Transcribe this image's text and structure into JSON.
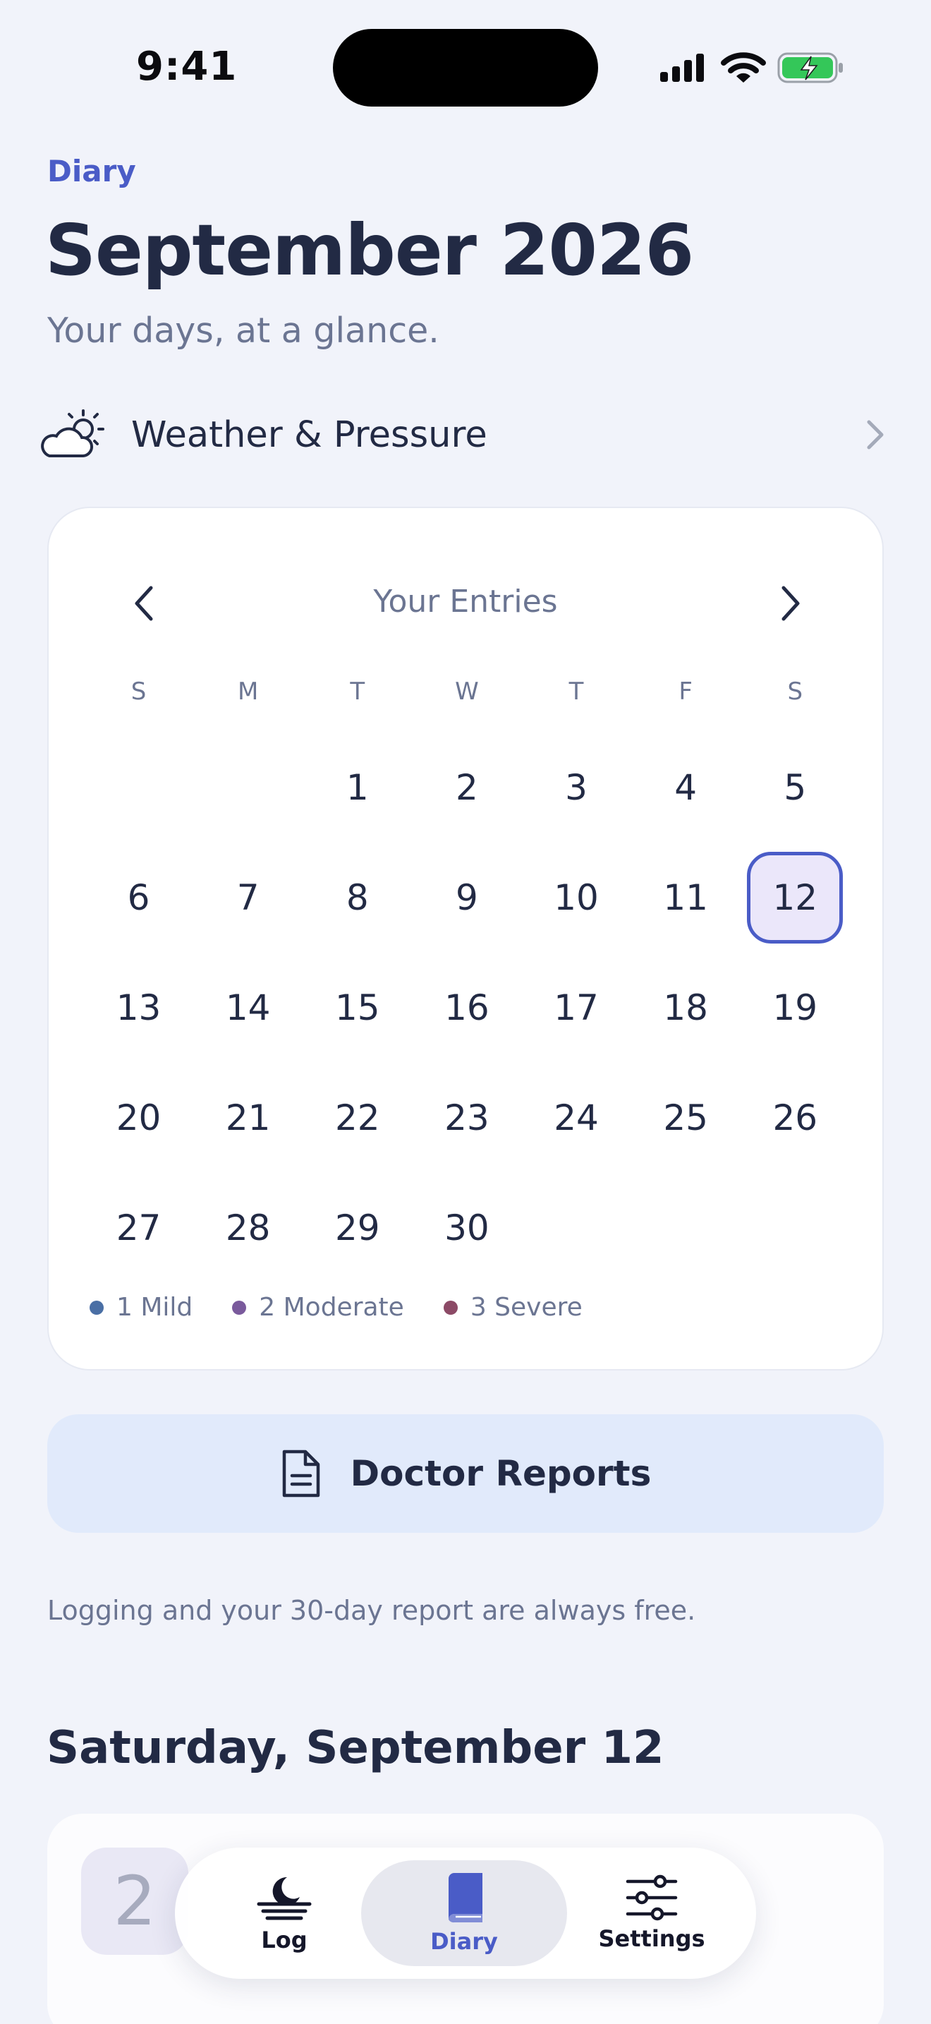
{
  "status_bar": {
    "time": "9:41"
  },
  "header": {
    "eyebrow": "Diary",
    "title": "September 2026",
    "subtitle": "Your days, at a glance."
  },
  "weather_row": {
    "label": "Weather & Pressure",
    "icon": "partly-cloudy-icon"
  },
  "calendar": {
    "title": "Your Entries",
    "weekdays": [
      "S",
      "M",
      "T",
      "W",
      "T",
      "F",
      "S"
    ],
    "days": [
      "",
      "",
      "1",
      "2",
      "3",
      "4",
      "5",
      "6",
      "7",
      "8",
      "9",
      "10",
      "11",
      "12",
      "13",
      "14",
      "15",
      "16",
      "17",
      "18",
      "19",
      "20",
      "21",
      "22",
      "23",
      "24",
      "25",
      "26",
      "27",
      "28",
      "29",
      "30",
      "",
      "",
      ""
    ],
    "selected_day": "12",
    "legend": [
      {
        "label": "1 Mild",
        "color": "#4a6fa5"
      },
      {
        "label": "2 Moderate",
        "color": "#7a5a9c"
      },
      {
        "label": "3 Severe",
        "color": "#8c4a66"
      }
    ]
  },
  "doctor_reports": {
    "label": "Doctor Reports"
  },
  "free_note": "Logging and your 30-day report are always free.",
  "section": {
    "date_heading": "Saturday, September 12"
  },
  "entry": {
    "severity": "2",
    "title": "",
    "subtitle": ""
  },
  "tabbar": {
    "tabs": [
      {
        "label": "Log",
        "icon": "moon-icon",
        "active": false
      },
      {
        "label": "Diary",
        "icon": "book-icon",
        "active": true
      },
      {
        "label": "Settings",
        "icon": "sliders-icon",
        "active": false
      }
    ]
  },
  "colors": {
    "accent": "#4a5cc7",
    "selected_fill": "#ebe7fa",
    "button_fill": "#e1eafb"
  }
}
